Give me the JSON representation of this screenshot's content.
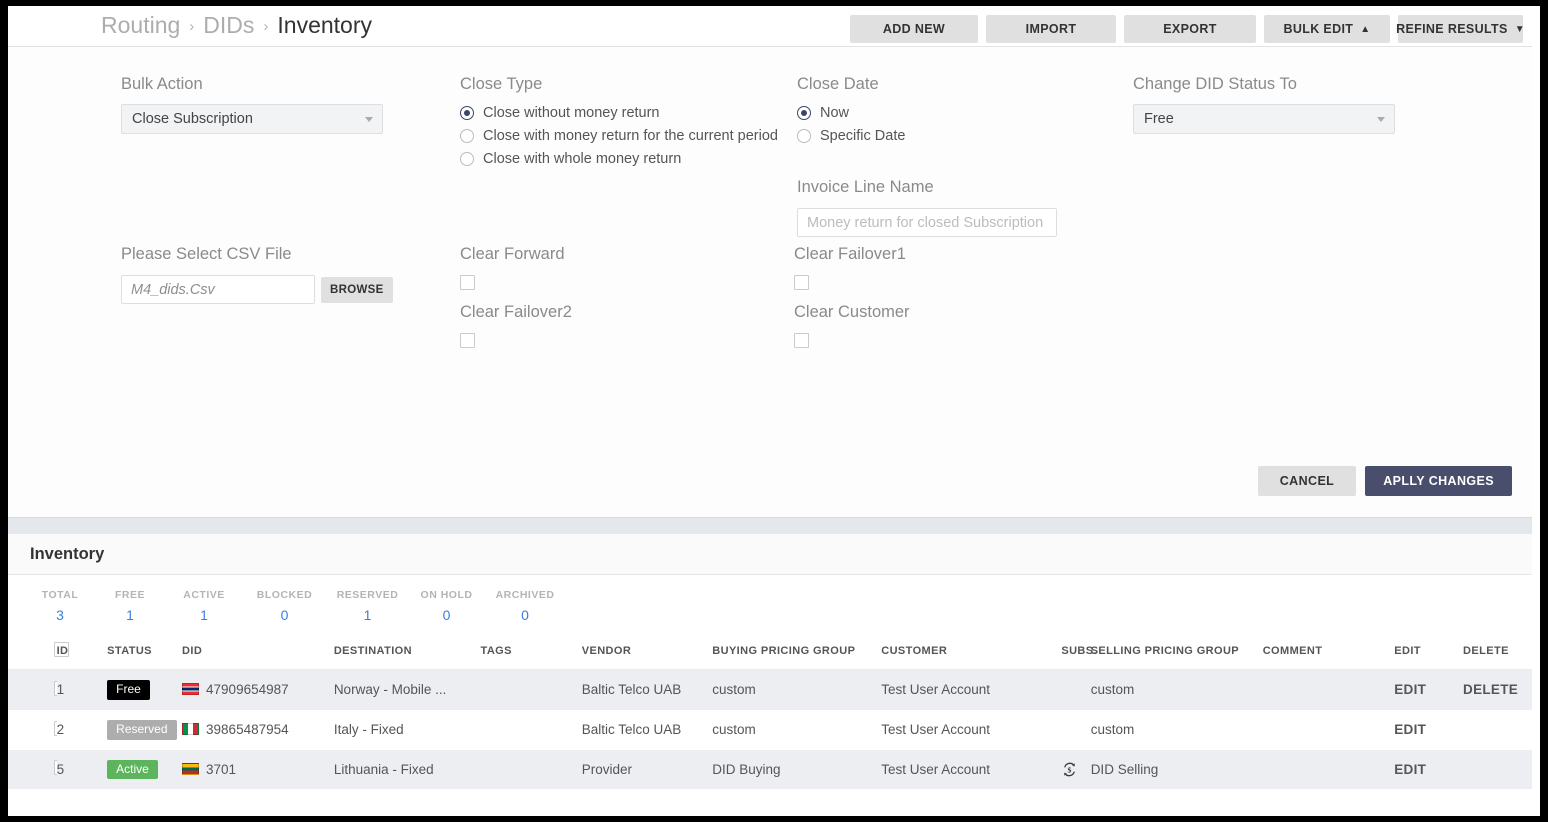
{
  "breadcrumb": {
    "items": [
      "Routing",
      "DIDs",
      "Inventory"
    ],
    "separator": "›"
  },
  "toolbar": {
    "add_new": "ADD NEW",
    "import": "IMPORT",
    "export": "EXPORT",
    "bulk_edit": "BULK EDIT",
    "bulk_edit_chevron": "⌃",
    "refine_results": "REFINE RESULTS",
    "refine_results_chevron": "⌄"
  },
  "form": {
    "bulk_action": {
      "label": "Bulk Action",
      "value": "Close Subscription"
    },
    "close_type": {
      "label": "Close Type",
      "options": [
        "Close without money return",
        "Close with money return for the current period",
        "Close with whole money return"
      ],
      "selected_index": 0
    },
    "close_date": {
      "label": "Close Date",
      "options": [
        "Now",
        "Specific Date"
      ],
      "selected_index": 0
    },
    "change_did_status": {
      "label": "Change DID Status To",
      "value": "Free"
    },
    "invoice_line_name": {
      "label": "Invoice Line Name",
      "placeholder": "Money return for closed Subscription",
      "value": ""
    },
    "csv_file": {
      "label": "Please Select CSV File",
      "placeholder": "M4_dids.Csv",
      "value": "",
      "browse_label": "BROWSE"
    },
    "clear_forward": {
      "label": "Clear Forward",
      "checked": false
    },
    "clear_failover1": {
      "label": "Clear Failover1",
      "checked": false
    },
    "clear_failover2": {
      "label": "Clear Failover2",
      "checked": false
    },
    "clear_customer": {
      "label": "Clear Customer",
      "checked": false
    },
    "cancel_label": "CANCEL",
    "apply_label": "APLLY CHANGES"
  },
  "inventory": {
    "title": "Inventory",
    "stats": [
      {
        "key": "TOTAL",
        "value": "3"
      },
      {
        "key": "FREE",
        "value": "1"
      },
      {
        "key": "ACTIVE",
        "value": "1"
      },
      {
        "key": "BLOCKED",
        "value": "0"
      },
      {
        "key": "RESERVED",
        "value": "1"
      },
      {
        "key": "ON HOLD",
        "value": "0"
      },
      {
        "key": "ARCHIVED",
        "value": "0"
      }
    ],
    "columns": [
      "ID",
      "STATUS",
      "DID",
      "DESTINATION",
      "TAGS",
      "VENDOR",
      "BUYING PRICING GROUP",
      "CUSTOMER",
      "SUBS.",
      "SELLING PRICING GROUP",
      "COMMENT",
      "EDIT",
      "DELETE"
    ],
    "rows": [
      {
        "id": "1",
        "status": "Free",
        "status_kind": "free",
        "flag": "norway",
        "did": "47909654987",
        "destination": "Norway - Mobile ...",
        "tags": "",
        "vendor": "Baltic Telco UAB",
        "buying_pricing_group": "custom",
        "customer": "Test User Account",
        "subs": "",
        "selling_pricing_group": "custom",
        "comment": "",
        "edit": "EDIT",
        "delete": "DELETE"
      },
      {
        "id": "2",
        "status": "Reserved",
        "status_kind": "reserved",
        "flag": "italy",
        "did": "39865487954",
        "destination": "Italy - Fixed",
        "tags": "",
        "vendor": "Baltic Telco UAB",
        "buying_pricing_group": "custom",
        "customer": "Test User Account",
        "subs": "",
        "selling_pricing_group": "custom",
        "comment": "",
        "edit": "EDIT",
        "delete": ""
      },
      {
        "id": "5",
        "status": "Active",
        "status_kind": "active",
        "flag": "lithuania",
        "did": "3701",
        "destination": "Lithuania - Fixed",
        "tags": "",
        "vendor": "Provider",
        "buying_pricing_group": "DID Buying",
        "customer": "Test User Account",
        "subs": "subscription-recurring-icon",
        "selling_pricing_group": "DID Selling",
        "comment": "",
        "edit": "EDIT",
        "delete": ""
      }
    ]
  },
  "colors": {
    "accent_blue": "#3b7edc",
    "apply_button": "#484e6b",
    "badge_free": "#000000",
    "badge_reserved": "#adadad",
    "badge_active": "#5cb55c",
    "radio_selected": "#3b4567"
  }
}
